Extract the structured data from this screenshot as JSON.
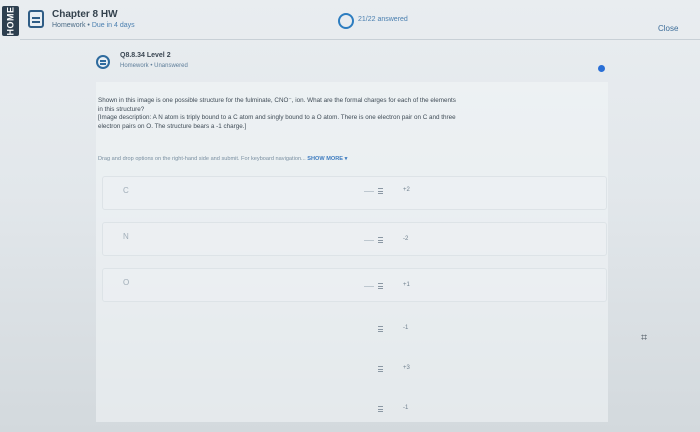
{
  "sidebar": {
    "tab_label": "HOME"
  },
  "header": {
    "title": "Chapter 8 HW",
    "subtitle_prefix": "Homework •",
    "due": "Due in 4 days",
    "progress_text": "21/22 answered",
    "close_label": "Close"
  },
  "question": {
    "title": "Q8.8.34 Level 2",
    "subtitle": "Homework • Unanswered",
    "text_lines": [
      "Shown in this image is one possible structure for the fulminate, CNO⁻, ion. What are the formal charges for each of the elements",
      "in this structure?",
      "[Image description: A N atom is triply bound to a C atom and singly bound to a O atom. There is one electron pair on C and three",
      "electron pairs on O. The structure bears a -1 charge.]"
    ],
    "instruction": "Drag and drop options on the right-hand side and submit. For keyboard navigation...",
    "show_more": "SHOW MORE ▾"
  },
  "targets": [
    {
      "label": "C"
    },
    {
      "label": "N"
    },
    {
      "label": "O"
    }
  ],
  "options": [
    {
      "value": "+2"
    },
    {
      "value": "-2"
    },
    {
      "value": "+1"
    },
    {
      "value": "-1"
    },
    {
      "value": "+3"
    },
    {
      "value": "-1"
    }
  ],
  "colors": {
    "accent": "#2a6fd6",
    "nav_dark": "#2d3f4f"
  },
  "icons": {
    "homework": "homework-clipboard-icon",
    "question": "question-clipboard-icon",
    "progress": "progress-ring-icon",
    "drag": "drag-handle-icon"
  }
}
